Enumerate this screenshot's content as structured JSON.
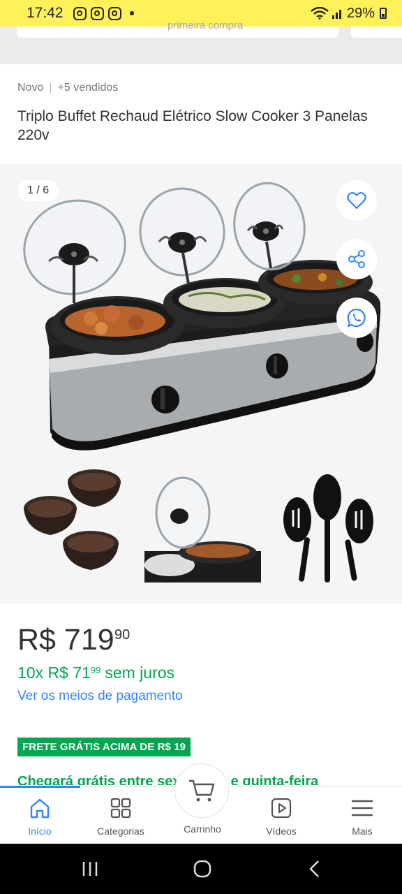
{
  "status_bar": {
    "time": "17:42",
    "battery": "29%"
  },
  "promo": {
    "text": "primeira compra"
  },
  "product": {
    "condition": "Novo",
    "sold": "+5 vendidos",
    "title": "Triplo Buffet Rechaud Elétrico Slow Cooker 3 Panelas 220v"
  },
  "gallery": {
    "counter": "1 / 6"
  },
  "price": {
    "main": "R$ 719",
    "cents": "90",
    "installments_prefix": "10x R$ 71",
    "installments_cents": "99",
    "installments_suffix": "sem juros",
    "payment_link": "Ver os meios de pagamento"
  },
  "shipping": {
    "badge": "FRETE GRÁTIS ACIMA DE R$ 19",
    "arrival": "Chegará grátis entre sexta-feira e quinta-feira"
  },
  "bottom_nav": {
    "items": [
      {
        "label": "Início"
      },
      {
        "label": "Categorias"
      },
      {
        "label": "Carrinho"
      },
      {
        "label": "Vídeos"
      },
      {
        "label": "Mais"
      }
    ]
  },
  "colors": {
    "accent": "#3483fa",
    "green": "#00a650",
    "yellow": "#fff159"
  }
}
